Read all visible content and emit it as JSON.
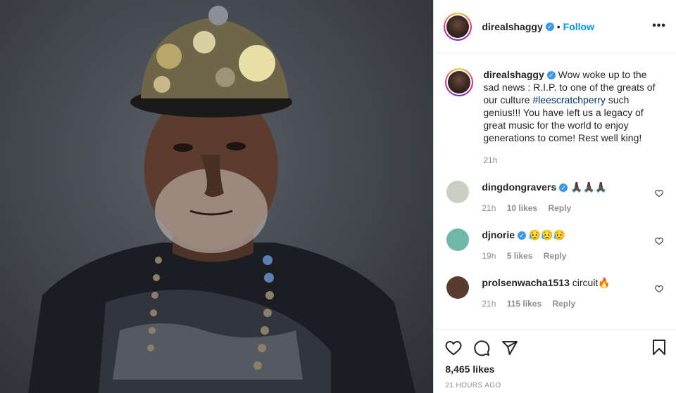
{
  "post": {
    "photo_alt": "",
    "author": {
      "username": "direalshaggy",
      "verified_icon": "verified-badge-icon",
      "follow_separator": "•",
      "follow_label": "Follow",
      "more_label": "•••"
    },
    "caption": {
      "username": "direalshaggy",
      "text_before": " Wow woke up to the sad news : R.I.P. to one of the greats of our culture ",
      "hashtag": "#leescratchperry",
      "text_after": " such genius!!! You have left us a legacy of great music for the world to enjoy generations to come! Rest well king!",
      "time": "21h"
    },
    "comments": [
      {
        "username": "dingdongravers",
        "verified": true,
        "text": " 🙏🏿🙏🏿🙏🏿",
        "time": "21h",
        "likes": "10 likes",
        "reply": "Reply",
        "avatar_color": "#c9cfc3"
      },
      {
        "username": "djnorie",
        "verified": true,
        "text": " 😥😥😥",
        "time": "19h",
        "likes": "5 likes",
        "reply": "Reply",
        "avatar_color": "#6fb7a8"
      },
      {
        "username": "prolsenwacha1513",
        "verified": false,
        "text": " circuit🔥",
        "time": "21h",
        "likes": "115 likes",
        "reply": "Reply",
        "avatar_color": "#5a3b30"
      }
    ],
    "likes_count": "8,465 likes",
    "post_time": "21 HOURS AGO"
  }
}
